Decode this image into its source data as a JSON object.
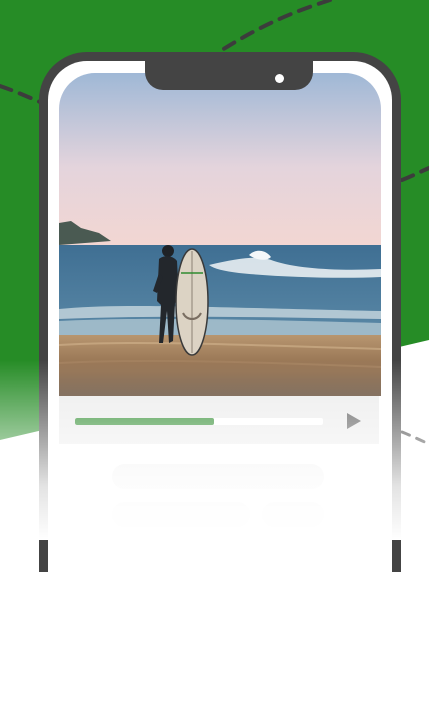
{
  "colors": {
    "brand_green": "#268c26",
    "phone_frame": "#444444",
    "progress_fill": "#2e8b2e",
    "player_background": "#ececec",
    "placeholder": "#efefef"
  },
  "video_player": {
    "progress": 0.56,
    "play_icon": "play-icon"
  },
  "content_placeholders": {
    "count": 3
  }
}
